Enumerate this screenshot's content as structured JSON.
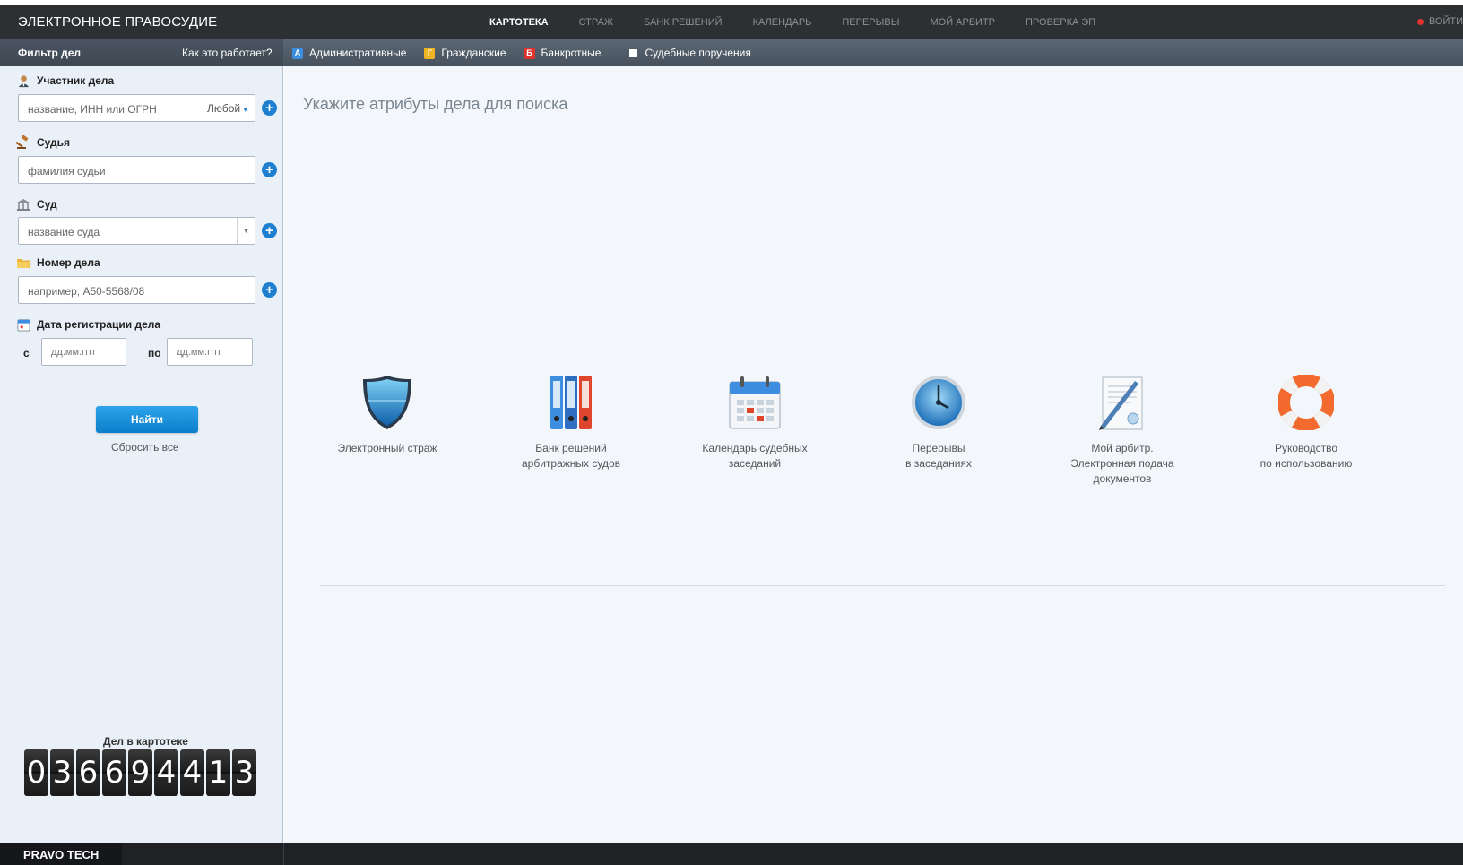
{
  "header": {
    "brand": "ЭЛЕКТРОННОЕ ПРАВОСУДИЕ",
    "nav": [
      {
        "label": "КАРТОТЕКА",
        "active": true
      },
      {
        "label": "СТРАЖ",
        "active": false
      },
      {
        "label": "БАНК РЕШЕНИЙ",
        "active": false
      },
      {
        "label": "КАЛЕНДАРЬ",
        "active": false
      },
      {
        "label": "ПЕРЕРЫВЫ",
        "active": false
      },
      {
        "label": "МОЙ АРБИТР",
        "active": false
      },
      {
        "label": "ПРОВЕРКА ЭП",
        "active": false
      }
    ],
    "login": "ВОЙТИ"
  },
  "subbar": {
    "filter_title": "Фильтр дел",
    "how_link": "Как это работает?",
    "types": [
      {
        "badge": "А",
        "label": "Административные",
        "color": "#3d8de0"
      },
      {
        "badge": "Г",
        "label": "Гражданские",
        "color": "#efb422"
      },
      {
        "badge": "Б",
        "label": "Банкротные",
        "color": "#e0332e"
      }
    ],
    "orders_label": "Судебные поручения"
  },
  "sidebar": {
    "participant": {
      "label": "Участник дела",
      "placeholder": "название, ИНН или ОГРН",
      "role": "Любой"
    },
    "judge": {
      "label": "Судья",
      "placeholder": "фамилия судьи"
    },
    "court": {
      "label": "Суд",
      "placeholder": "название суда"
    },
    "case_number": {
      "label": "Номер дела",
      "placeholder": "например, А50-5568/08"
    },
    "reg_date": {
      "label": "Дата регистрации дела",
      "from_label": "с",
      "to_label": "по",
      "from_placeholder": "дд.мм.гггг",
      "to_placeholder": "дд.мм.гггг"
    },
    "find_button": "Найти",
    "reset_link": "Сбросить все",
    "counter_label": "Дел в картотеке",
    "counter_digits": [
      "0",
      "3",
      "6",
      "6",
      "9",
      "4",
      "4",
      "1",
      "3"
    ]
  },
  "main": {
    "title": "Укажите атрибуты дела для поиска",
    "services": [
      {
        "icon": "shield-icon",
        "lines": [
          "Электронный страж"
        ]
      },
      {
        "icon": "binders-icon",
        "lines": [
          "Банк решений",
          "арбитражных судов"
        ]
      },
      {
        "icon": "calendar-icon",
        "lines": [
          "Календарь судебных",
          "заседаний"
        ]
      },
      {
        "icon": "clock-icon",
        "lines": [
          "Перерывы",
          "в заседаниях"
        ]
      },
      {
        "icon": "document-pen-icon",
        "lines": [
          "Мой арбитр.",
          "Электронная подача",
          "документов"
        ]
      },
      {
        "icon": "lifebuoy-icon",
        "lines": [
          "Руководство",
          "по использованию"
        ]
      }
    ]
  },
  "footer": {
    "logo": "PRAVO TECH"
  }
}
